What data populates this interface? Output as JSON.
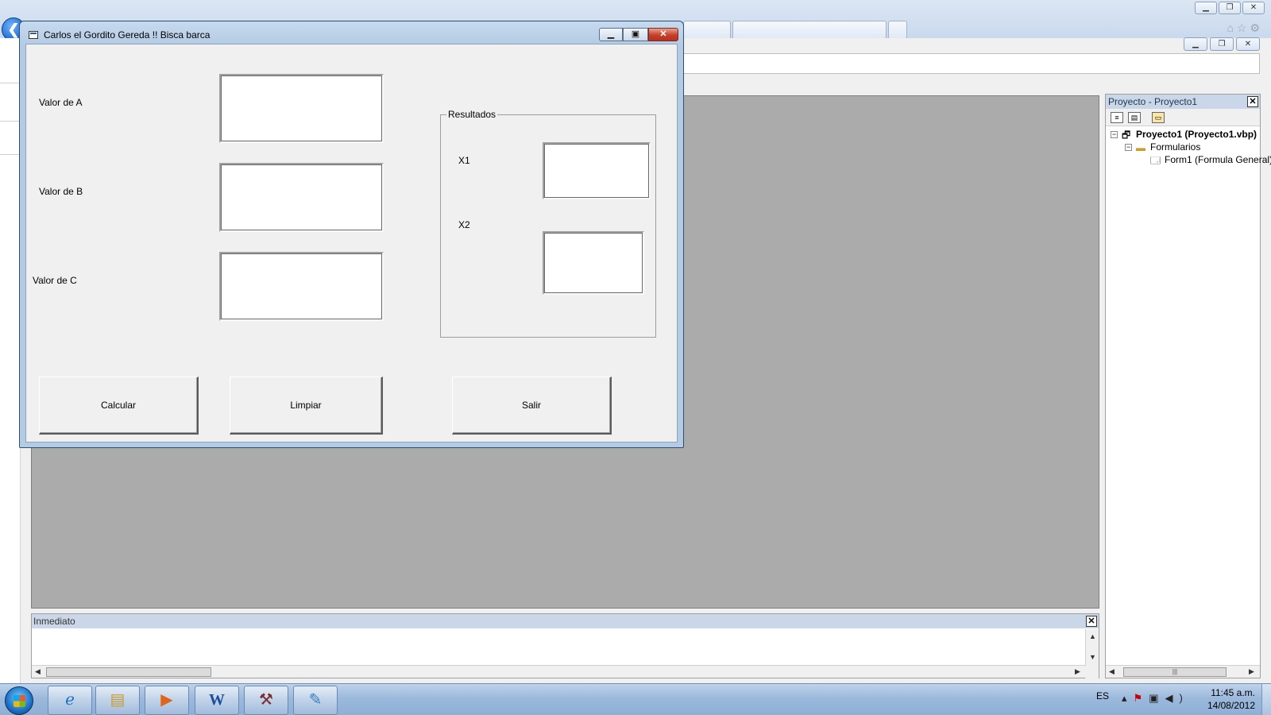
{
  "form": {
    "title": "Carlos el Gordito Gereda !! Bisca barca",
    "label_a": "Valor de A",
    "label_b": "Valor de B",
    "label_c": "Valor de C",
    "frame_caption": "Resultados",
    "label_x1": "X1",
    "label_x2": "X2",
    "calc_button": "Calcular",
    "clear_button": "Limpiar",
    "exit_button": "Salir",
    "value_a": "",
    "value_b": "",
    "value_c": "",
    "value_x1": "",
    "value_x2": ""
  },
  "ide": {
    "project_panel_title": "Proyecto - Proyecto1",
    "tree": {
      "project": "Proyecto1 (Proyecto1.vbp)",
      "folder": "Formularios",
      "form_item": "Form1 (Formula General)"
    },
    "immediate_title": "Inmediato"
  },
  "taskbar": {
    "language": "ES",
    "time": "11:45 a.m.",
    "date": "14/08/2012"
  },
  "colors": {
    "form_frame": "#b4cbe4",
    "close_button": "#c5402a",
    "ide_workspace": "#ababab",
    "taskbar": "#9cb9dc"
  }
}
